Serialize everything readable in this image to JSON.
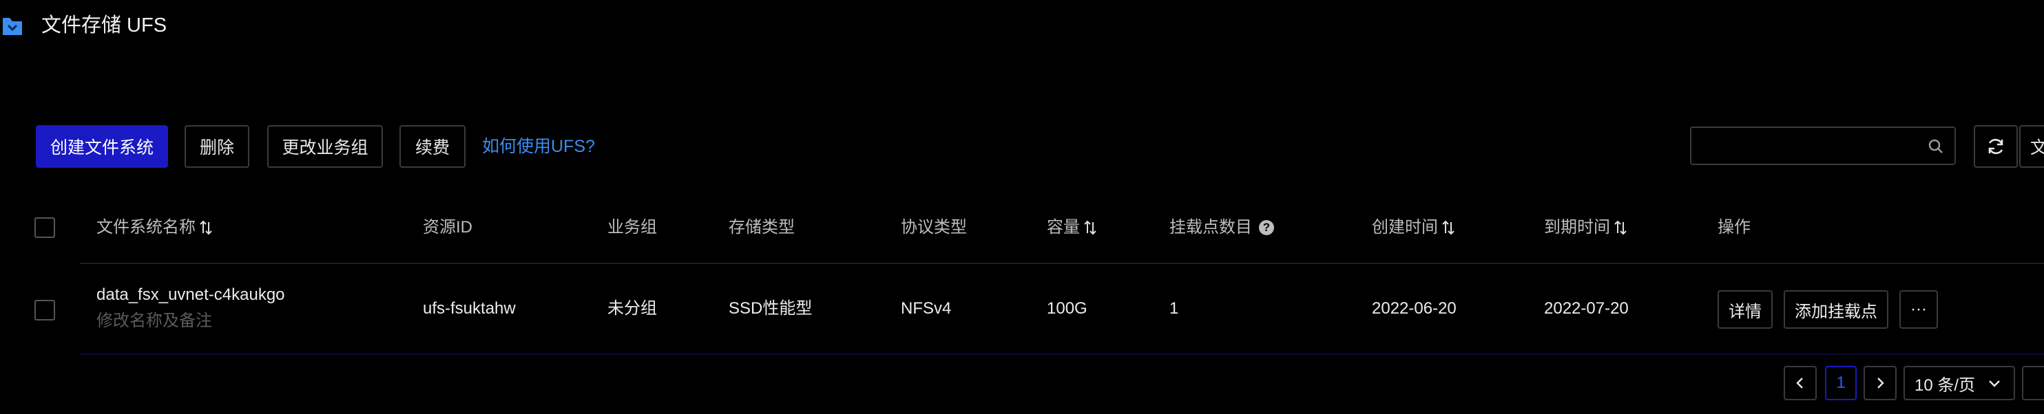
{
  "header": {
    "title": "文件存储 UFS",
    "icon": "folder-icon",
    "accent": "#3a8ef0"
  },
  "toolbar": {
    "create_label": "创建文件系统",
    "delete_label": "删除",
    "change_group_label": "更改业务组",
    "renew_label": "续费",
    "help_link": "如何使用UFS?",
    "search_value": "",
    "more_label": "文",
    "primary_color": "#1a1ac4"
  },
  "table": {
    "columns": {
      "name": "文件系统名称",
      "resource_id": "资源ID",
      "group": "业务组",
      "storage_type": "存储类型",
      "protocol": "协议类型",
      "capacity": "容量",
      "mount_count": "挂载点数目",
      "created": "创建时间",
      "expires": "到期时间",
      "actions": "操作"
    },
    "rows": [
      {
        "name": "data_fsx_uvnet-c4kaukgo",
        "remark": "修改名称及备注",
        "resource_id": "ufs-fsuktahw",
        "group": "未分组",
        "storage_type": "SSD性能型",
        "protocol": "NFSv4",
        "capacity": "100G",
        "mount_count": "1",
        "created": "2022-06-20",
        "expires": "2022-07-20",
        "actions": {
          "detail": "详情",
          "add_mount": "添加挂载点",
          "more": "···"
        }
      }
    ]
  },
  "pagination": {
    "current_page": "1",
    "page_size": "10 条/页"
  }
}
